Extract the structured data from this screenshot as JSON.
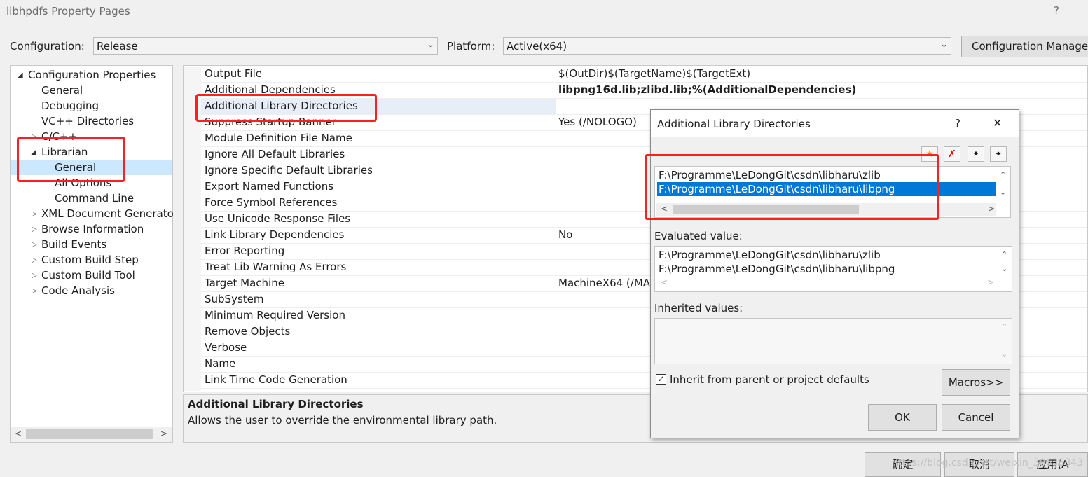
{
  "window": {
    "title": "libhpdfs Property Pages",
    "help": "?"
  },
  "config": {
    "label": "Configuration:",
    "value": "Release",
    "platform_label": "Platform:",
    "platform_value": "Active(x64)",
    "manager_button": "Configuration Manager"
  },
  "tree": {
    "root": "Configuration Properties",
    "general": "General",
    "debugging": "Debugging",
    "vc_dirs": "VC++ Directories",
    "cpp": "C/C++",
    "librarian": "Librarian",
    "lib_general": "General",
    "lib_all_options": "All Options",
    "lib_command_line": "Command Line",
    "xml_doc": "XML Document Generato",
    "browse_info": "Browse Information",
    "build_events": "Build Events",
    "custom_build_step": "Custom Build Step",
    "custom_build_tool": "Custom Build Tool",
    "code_analysis": "Code Analysis"
  },
  "grid": {
    "rows": [
      {
        "name": "Output File",
        "value": "$(OutDir)$(TargetName)$(TargetExt)"
      },
      {
        "name": "Additional Dependencies",
        "value": "libpng16d.lib;zlibd.lib;%(AdditionalDependencies)"
      },
      {
        "name": "Additional Library Directories",
        "value": ""
      },
      {
        "name": "Suppress Startup Banner",
        "value": "Yes (/NOLOGO)"
      },
      {
        "name": "Module Definition File Name",
        "value": ""
      },
      {
        "name": "Ignore All Default Libraries",
        "value": ""
      },
      {
        "name": "Ignore Specific Default Libraries",
        "value": ""
      },
      {
        "name": "Export Named Functions",
        "value": ""
      },
      {
        "name": "Force Symbol References",
        "value": ""
      },
      {
        "name": "Use Unicode Response Files",
        "value": ""
      },
      {
        "name": "Link Library Dependencies",
        "value": "No"
      },
      {
        "name": "Error Reporting",
        "value": ""
      },
      {
        "name": "Treat Lib Warning As Errors",
        "value": ""
      },
      {
        "name": "Target Machine",
        "value": "MachineX64 (/MA"
      },
      {
        "name": "SubSystem",
        "value": ""
      },
      {
        "name": "Minimum Required Version",
        "value": ""
      },
      {
        "name": "Remove Objects",
        "value": ""
      },
      {
        "name": "Verbose",
        "value": ""
      },
      {
        "name": "Name",
        "value": ""
      },
      {
        "name": "Link Time Code Generation",
        "value": ""
      }
    ]
  },
  "description": {
    "title": "Additional Library Directories",
    "text": "Allows the user to override the environmental library path."
  },
  "dialog": {
    "title": "Additional Library Directories",
    "help": "?",
    "close": "✕",
    "entries": [
      "F:\\Programme\\LeDongGit\\csdn\\libharu\\zlib",
      "F:\\Programme\\LeDongGit\\csdn\\libharu\\libpng"
    ],
    "evaluated_label": "Evaluated value:",
    "evaluated": [
      "F:\\Programme\\LeDongGit\\csdn\\libharu\\zlib",
      "F:\\Programme\\LeDongGit\\csdn\\libharu\\libpng"
    ],
    "inherited_label": "Inherited values:",
    "inherit_checkbox": "Inherit from parent or project defaults",
    "inherit_checked": true,
    "macros_button": "Macros>>",
    "ok": "OK",
    "cancel": "Cancel"
  },
  "bottom": {
    "ok": "确定",
    "cancel": "取消",
    "apply": "应用(A",
    "watermark": "https://blog.csdn.net/weixin_38636843"
  },
  "colors": {
    "highlight": "#0078d7",
    "annotation": "#ff1f1f",
    "selected_tree": "#cce8ff"
  }
}
